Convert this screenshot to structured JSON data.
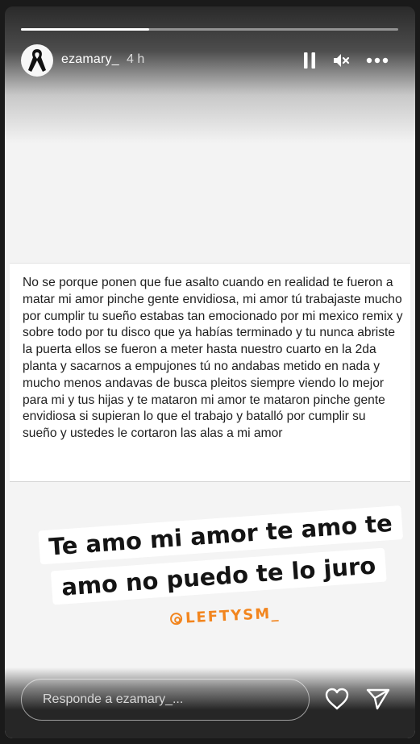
{
  "story": {
    "progress_fraction": 0.34,
    "username": "ezamary_",
    "timestamp": "4 h"
  },
  "controls": {
    "pause_icon": "pause-icon",
    "mute_icon": "muted-speaker-icon",
    "more_icon": "more-dots-icon"
  },
  "post": {
    "text": "No se porque ponen que fue asalto cuando en realidad te fueron a matar mi amor pinche gente envidiosa, mi amor tú trabajaste mucho por cumplir tu sueño estabas tan emocionado por mi mexico remix y sobre todo por tu disco que ya habías terminado y tu nunca abriste la puerta ellos se fueron a meter hasta nuestro cuarto en la 2da planta y sacarnos a empujones tú no andabas metido en nada y mucho menos andavas de busca pleitos siempre viendo lo mejor para mi y tus hijas y te mataron mi amor te mataron pinche gente envidiosa si supieran lo que el trabajo y batalló por cumplir su sueño y ustedes le cortaron las alas a mi amor"
  },
  "sticker": {
    "line1": "Te amo mi amor te amo te",
    "line2": "amo no puedo te lo juro",
    "mention": "LEFTYSM_"
  },
  "reply": {
    "placeholder": "Responde a ezamary_..."
  },
  "actions": {
    "like_icon": "heart-icon",
    "share_icon": "send-icon"
  },
  "colors": {
    "mention": "#f2851e",
    "sticker_bg": "#ffffff",
    "overlay": "#262626"
  }
}
